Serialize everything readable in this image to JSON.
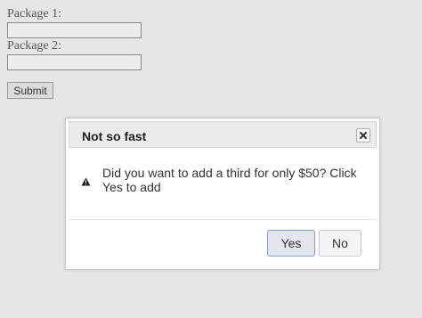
{
  "form": {
    "package1_label": "Package 1:",
    "package1_value": "",
    "package2_label": "Package 2:",
    "package2_value": "",
    "submit_label": "Submit"
  },
  "dialog": {
    "title": "Not so fast",
    "close_icon": "close-icon",
    "warning_icon": "warning-icon",
    "message": "Did you want to add a third for only $50? Click Yes to add",
    "yes_label": "Yes",
    "no_label": "No"
  }
}
